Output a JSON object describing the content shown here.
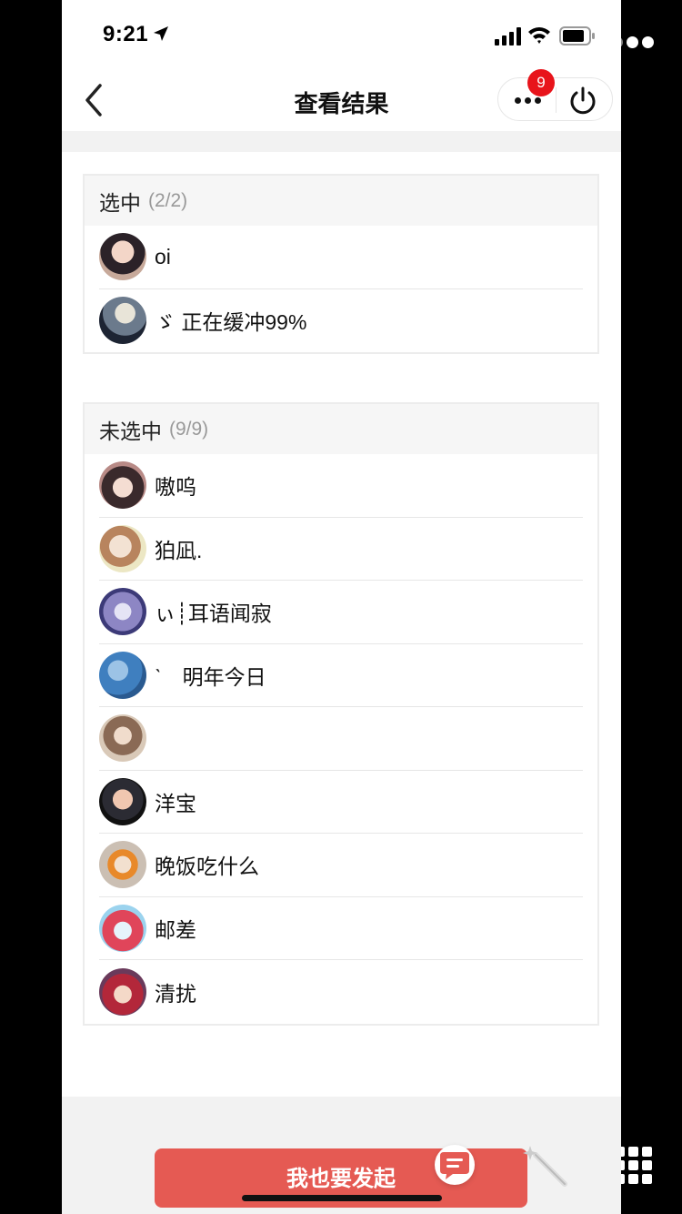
{
  "status": {
    "time": "9:21"
  },
  "nav": {
    "title": "查看结果",
    "badge": "9"
  },
  "selected": {
    "title": "选中",
    "count": "(2/2)",
    "items": [
      {
        "name": "oi"
      },
      {
        "name": "ゞ 正在缓冲99%"
      }
    ]
  },
  "unselected": {
    "title": "未选中",
    "count": "(9/9)",
    "items": [
      {
        "name": "嗷呜"
      },
      {
        "name": "狛凪."
      },
      {
        "name": "ぃ┊耳语闻寂"
      },
      {
        "name": "ˋ　明年今日"
      },
      {
        "name": ""
      },
      {
        "name": "洋宝"
      },
      {
        "name": "晚饭吃什么"
      },
      {
        "name": "邮差"
      },
      {
        "name": "清扰"
      }
    ]
  },
  "footer": {
    "button_label": "我也要发起"
  },
  "colors": {
    "accent": "#e55a53",
    "badge": "#e8141b"
  }
}
